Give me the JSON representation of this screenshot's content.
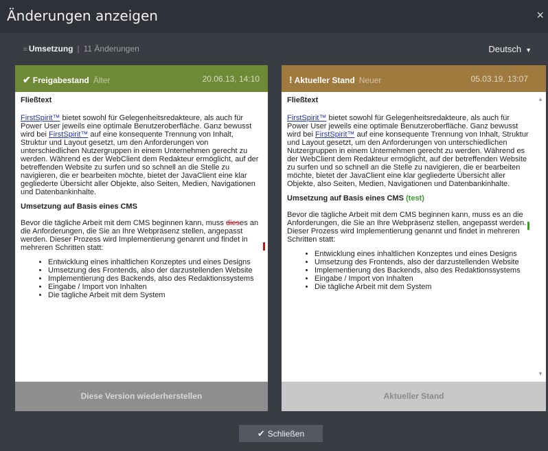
{
  "dialog": {
    "title": "Änderungen anzeigen",
    "close_glyph": "×"
  },
  "subbar": {
    "icon": "lines-icon",
    "view": "Umsetzung",
    "separator": "|",
    "change_count": "11 Änderungen",
    "language": "Deutsch"
  },
  "left": {
    "state": "Freigabestand",
    "age": "Älter",
    "date": "20.06.13, 14:10",
    "accent": "#6e8a36",
    "footer_button": "Diese Version wiederherstellen"
  },
  "right": {
    "state": "Aktueller Stand",
    "age": "Neuer",
    "date": "05.03.19, 13:07",
    "accent": "#9e7a3e",
    "footer_label": "Aktueller Stand"
  },
  "content": {
    "heading1": "Fließtext",
    "link": "FirstSpirit™",
    "p1_a": " bietet sowohl für Gelegenheitsredakteure, als auch für Power User jeweils eine optimale Benutzeroberfläche. Ganz bewusst wird bei ",
    "p1_b": " auf eine konsequente Trennung von Inhalt, Struktur und Layout gesetzt, um den Anforderungen von unterschiedlichen Nutzergruppen in einem Unternehmen gerecht zu werden. Während es der WebClient dem Redakteur ermöglicht, auf der betreffenden Website zu surfen und so schnell an die Stelle zu navigieren, die er bearbeiten möchte, bietet der JavaClient eine klar gegliederte Übersicht aller Objekte, also Seiten, Medien, Navigationen und Datenbankinhalte.",
    "heading2": "Umsetzung auf Basis eines CMS",
    "heading2_added": "(test)",
    "p2_left_a": "Bevor die tägliche Arbeit mit dem CMS beginnen kann, muss ",
    "p2_left_del": "dies",
    "p2_left_b": "es an die Anforderungen, die Sie an Ihre Webpräsenz stellen, angepasst werden. Dieser Prozess wird Implementierung genannt und findet in mehreren Schritten statt:",
    "p2_right": "Bevor die tägliche Arbeit mit dem CMS beginnen kann, muss es an die Anforderungen, die Sie an Ihre Webpräsenz stellen, angepasst werden. Dieser Prozess wird Implementierung genannt und findet in mehreren Schritten statt:",
    "list": [
      "Entwicklung eines inhaltlichen Konzeptes und eines Designs",
      "Umsetzung des Frontends, also der darzustellenden Website",
      "Implementierung des Backends, also des Redaktionssystems",
      "Eingabe / Import von Inhalten",
      "Die tägliche Arbeit mit dem System"
    ]
  },
  "footer": {
    "close_button": "Schließen"
  },
  "colors": {
    "deleted": "#c0202a",
    "added": "#3c9a2d"
  }
}
